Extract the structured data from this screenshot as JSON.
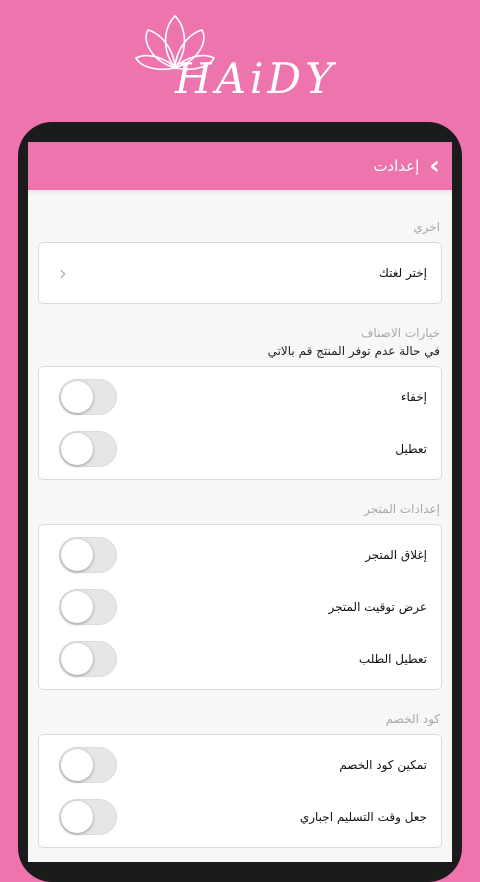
{
  "brand": {
    "logo_text": "HAiDY",
    "accent": "#ee74ad"
  },
  "header": {
    "title": "إعدادت",
    "back_icon": "chevron-right-icon"
  },
  "sections": {
    "other": {
      "title": "اخري",
      "language_label": "إختر لغتك"
    },
    "categories": {
      "title": "خيارات الاصناف",
      "subtitle": "في حالة عدم توفر المنتج قم بالاتي",
      "hide_label": "إخفاء",
      "disable_label": "تعطيل"
    },
    "store": {
      "title": "إعدادات المتجر",
      "close_store_label": "إغلاق المتجر",
      "show_hours_label": "عرض توقيت المتجر",
      "disable_orders_label": "تعطيل الطلب"
    },
    "discount": {
      "title": "كود الخصم",
      "enable_code_label": "تمكين كود الخصم",
      "mandatory_delivery_label": "جعل وقت التسليم اجباري"
    }
  }
}
